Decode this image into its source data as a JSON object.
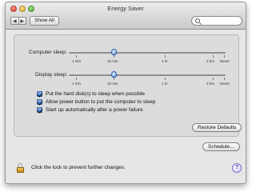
{
  "window": {
    "title": "Energy Saver"
  },
  "toolbar": {
    "back_glyph": "◀",
    "forward_glyph": "▶",
    "show_all_label": "Show All",
    "search": {
      "value": "",
      "placeholder": ""
    }
  },
  "computer_sleep": {
    "label": "Computer sleep:",
    "value": "15 min",
    "ticks": [
      "1 min",
      "15 min",
      "1 hr",
      "3 hrs",
      "Never"
    ]
  },
  "display_sleep": {
    "label": "Display sleep:",
    "value": "15 min",
    "ticks": [
      "1 min",
      "15 min",
      "1 hr",
      "3 hrs",
      "Never"
    ]
  },
  "options": [
    {
      "label": "Put the hard disk(s) to sleep when possible",
      "checked": true
    },
    {
      "label": "Allow power button to put the computer to sleep",
      "checked": true
    },
    {
      "label": "Start up automatically after a power failure",
      "checked": true
    }
  ],
  "buttons": {
    "restore_defaults": "Restore Defaults",
    "schedule": "Schedule..."
  },
  "footer": {
    "lock_text": "Click the lock to prevent further changes.",
    "help_glyph": "?"
  }
}
